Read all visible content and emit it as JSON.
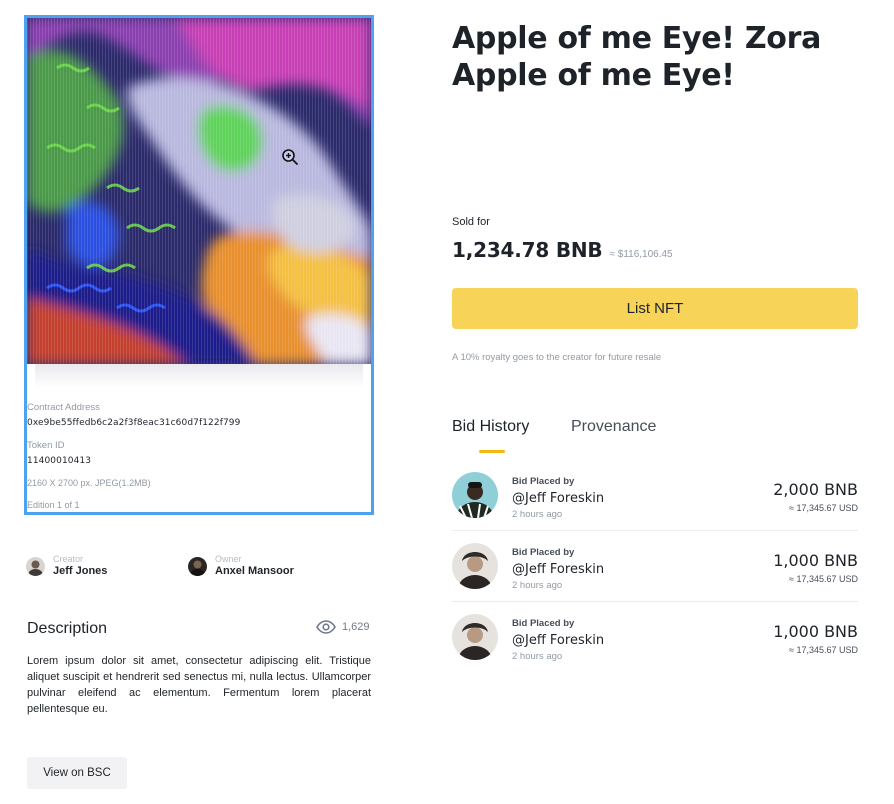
{
  "nft": {
    "title": "Apple of me Eye! Zora Apple of me Eye!",
    "contract_label": "Contract Address",
    "contract_address": "0xe9be55ffedb6c2a2f3f8eac31c60d7f122f799",
    "token_label": "Token ID",
    "token_id": "11400010413",
    "dimensions": "2160 X 2700 px. JPEG(1.2MB)",
    "edition": "Edition 1 of 1"
  },
  "creator": {
    "role": "Creator",
    "name": "Jeff Jones"
  },
  "owner": {
    "role": "Owner",
    "name": "Anxel Mansoor"
  },
  "description": {
    "title": "Description",
    "views": "1,629",
    "text": "Lorem ipsum dolor sit amet, consectetur adipiscing elit. Tristique aliquet suscipit et hendrerit sed senectus mi, nulla lectus. Ullamcorper pulvinar eleifend ac elementum. Fermentum lorem placerat pellentesque eu."
  },
  "actions": {
    "view_bsc": "View on BSC",
    "list_nft": "List NFT"
  },
  "sale": {
    "sold_label": "Sold for",
    "price": "1,234.78 BNB",
    "price_usd": "≈ $116,106.45",
    "royalty_note": "A 10% royalty goes to the creator for future resale"
  },
  "tabs": {
    "bid_history": "Bid History",
    "provenance": "Provenance"
  },
  "bids": [
    {
      "placed_by_label": "Bid Placed by",
      "user": "@Jeff Foreskin",
      "time": "2 hours ago",
      "amount": "2,000 BNB",
      "usd": "≈ 17,345.67 USD"
    },
    {
      "placed_by_label": "Bid Placed by",
      "user": "@Jeff Foreskin",
      "time": "2 hours ago",
      "amount": "1,000 BNB",
      "usd": "≈ 17,345.67 USD"
    },
    {
      "placed_by_label": "Bid Placed by",
      "user": "@Jeff Foreskin",
      "time": "2 hours ago",
      "amount": "1,000 BNB",
      "usd": "≈ 17,345.67 USD"
    }
  ],
  "colors": {
    "accent": "#f7d358",
    "tab_underline": "#f0b90b",
    "selection_border": "#4da3f0",
    "text_primary": "#1e2329",
    "text_muted": "#929aa5"
  },
  "icons": {
    "zoom": "zoom-in-icon",
    "views": "eye-icon"
  }
}
